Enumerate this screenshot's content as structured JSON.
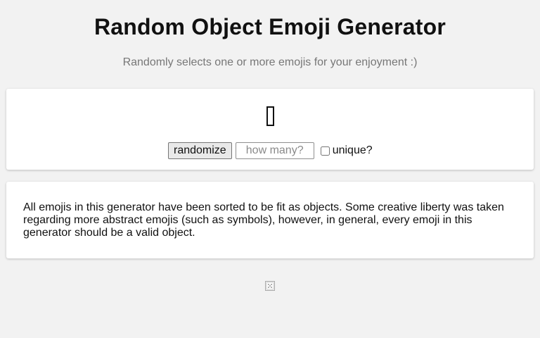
{
  "header": {
    "title": "Random Object Emoji Generator",
    "subtitle": "Randomly selects one or more emojis for your enjoyment :)"
  },
  "generator": {
    "result_emoji": "▯",
    "randomize_label": "randomize",
    "quantity_placeholder": "how many?",
    "quantity_value": "",
    "unique_label": "unique?",
    "unique_checked": false
  },
  "info": {
    "text": "All emojis in this generator have been sorted to be fit as objects. Some creative liberty was taken regarding more abstract emojis (such as symbols), however, in general, every emoji in this generator should be a valid object."
  },
  "footer": {
    "icon": "broken-image-icon"
  }
}
